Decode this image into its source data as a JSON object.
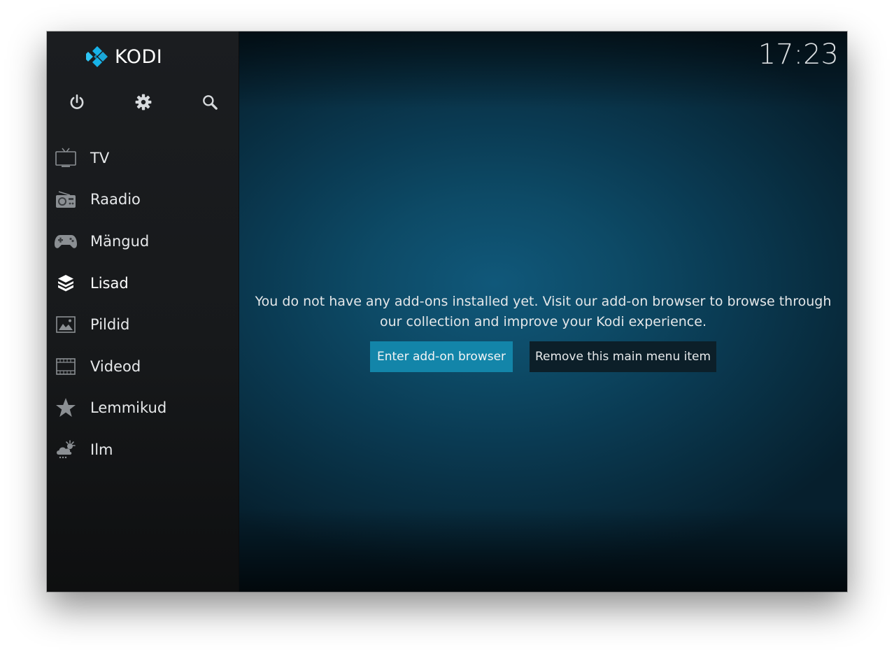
{
  "app": {
    "logo_text": "KODI",
    "clock": "17:23"
  },
  "top_icons": [
    {
      "name": "power-icon"
    },
    {
      "name": "gear-icon"
    },
    {
      "name": "search-icon"
    }
  ],
  "menu": {
    "items": [
      {
        "label": "TV",
        "icon": "tv-icon"
      },
      {
        "label": "Raadio",
        "icon": "radio-icon"
      },
      {
        "label": "Mängud",
        "icon": "gamepad-icon"
      },
      {
        "label": "Lisad",
        "icon": "addon-box-icon",
        "active": true
      },
      {
        "label": "Pildid",
        "icon": "picture-icon"
      },
      {
        "label": "Videod",
        "icon": "film-icon"
      },
      {
        "label": "Lemmikud",
        "icon": "star-icon"
      },
      {
        "label": "Ilm",
        "icon": "weather-icon"
      }
    ]
  },
  "main": {
    "message_line1": "You do not have any add-ons installed yet. Visit our add-on browser to browse through",
    "message_line2": "our collection and improve your Kodi experience.",
    "primary_button": "Enter add-on browser",
    "secondary_button": "Remove this main menu item"
  },
  "colors": {
    "accent": "#1385a9",
    "sidebar": "#1b1d20",
    "main_bg": "#0d4a66",
    "logo_blue": "#17b2e8"
  }
}
